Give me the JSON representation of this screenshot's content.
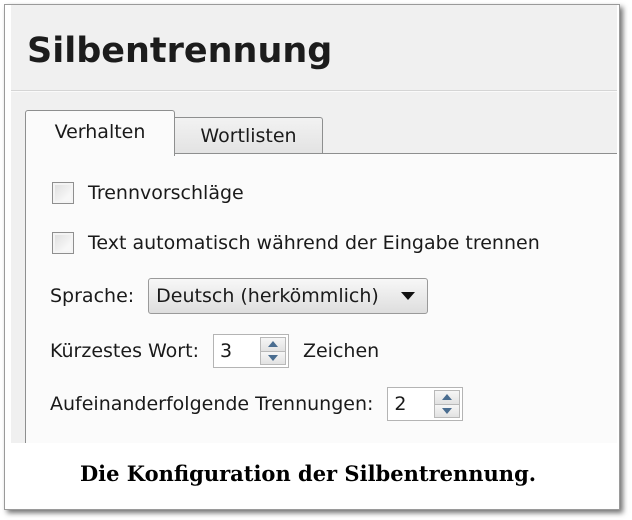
{
  "dialog": {
    "title": "Silbentrennung",
    "tabs": [
      {
        "label": "Verhalten",
        "active": true
      },
      {
        "label": "Wortlisten",
        "active": false
      }
    ],
    "options": {
      "suggestions_label": "Trennvorschläge",
      "suggestions_checked": false,
      "auto_hyphenate_label": "Text automatisch während der Eingabe trennen",
      "auto_hyphenate_checked": false
    },
    "language": {
      "label": "Sprache:",
      "selected": "Deutsch (herkömmlich)"
    },
    "shortest_word": {
      "label": "Kürzestes Wort:",
      "value": "3",
      "unit": "Zeichen"
    },
    "consecutive": {
      "label": "Aufeinanderfolgende Trennungen:",
      "value": "2"
    }
  },
  "caption": "Die Konfiguration der Silbentrennung."
}
